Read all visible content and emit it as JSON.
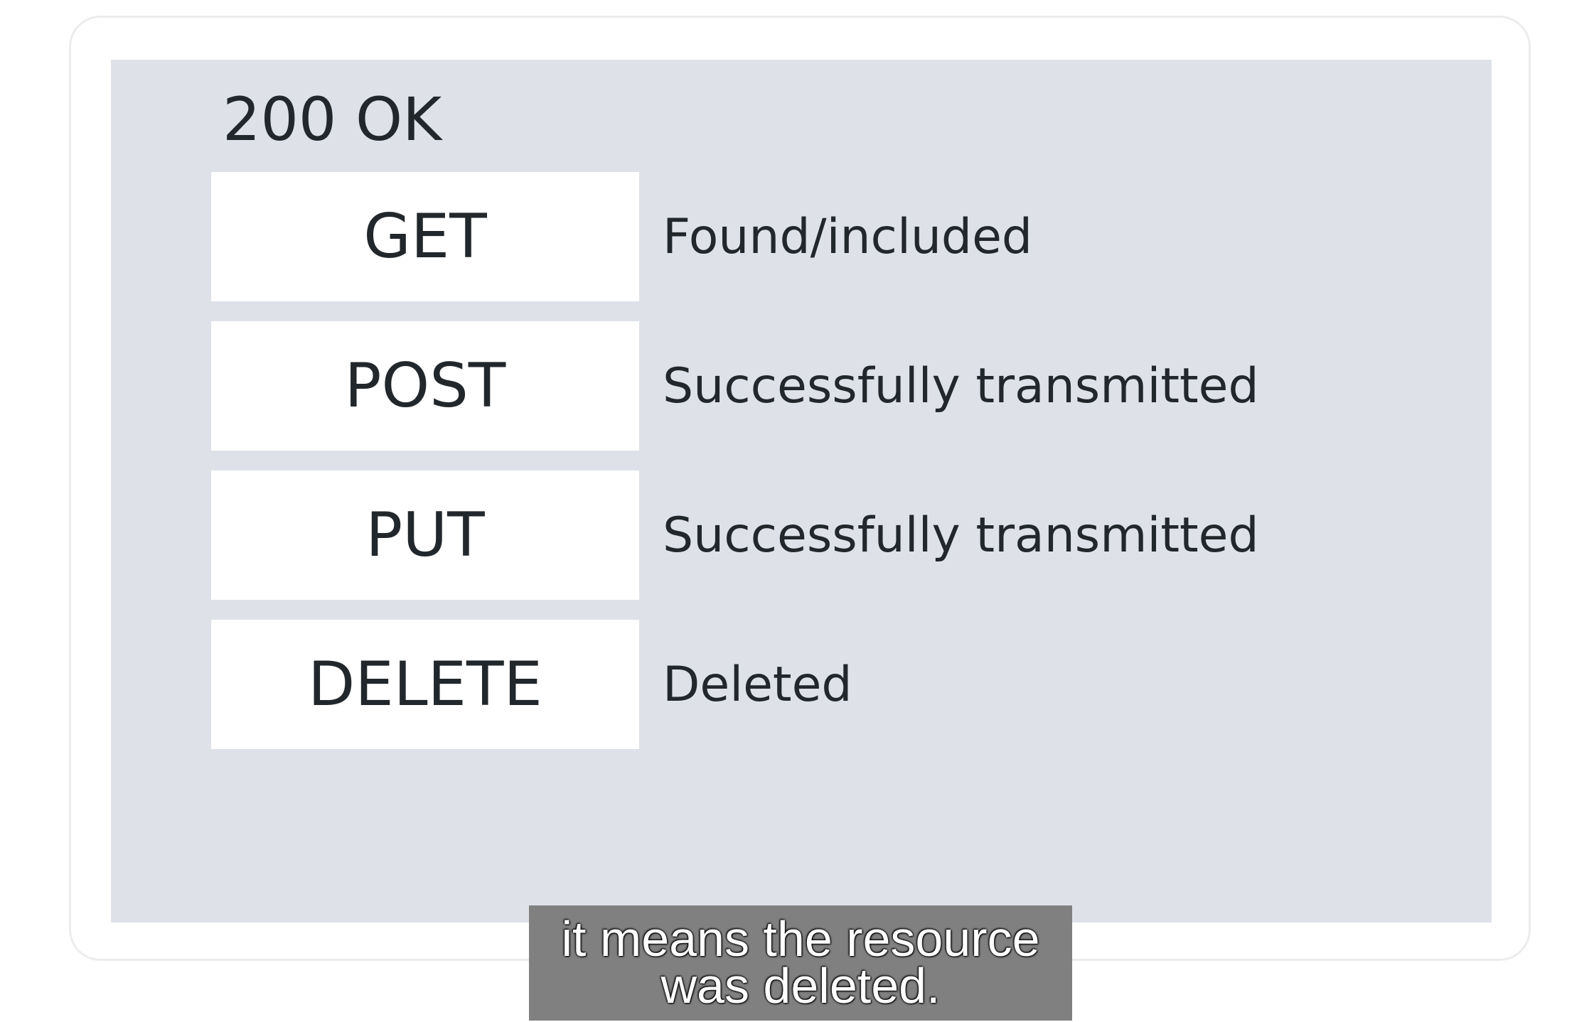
{
  "slide": {
    "heading": "200 OK",
    "rows": [
      {
        "method": "GET",
        "description": "Found/included"
      },
      {
        "method": "POST",
        "description": "Successfully transmitted"
      },
      {
        "method": "PUT",
        "description": "Successfully transmitted"
      },
      {
        "method": "DELETE",
        "description": "Deleted"
      }
    ]
  },
  "caption": {
    "line1": "it means the resource",
    "line2": "was deleted."
  },
  "colors": {
    "slide_background": "#dee2e8",
    "box_background": "#ffffff",
    "text": "#22272b",
    "caption_background": "#808080"
  }
}
